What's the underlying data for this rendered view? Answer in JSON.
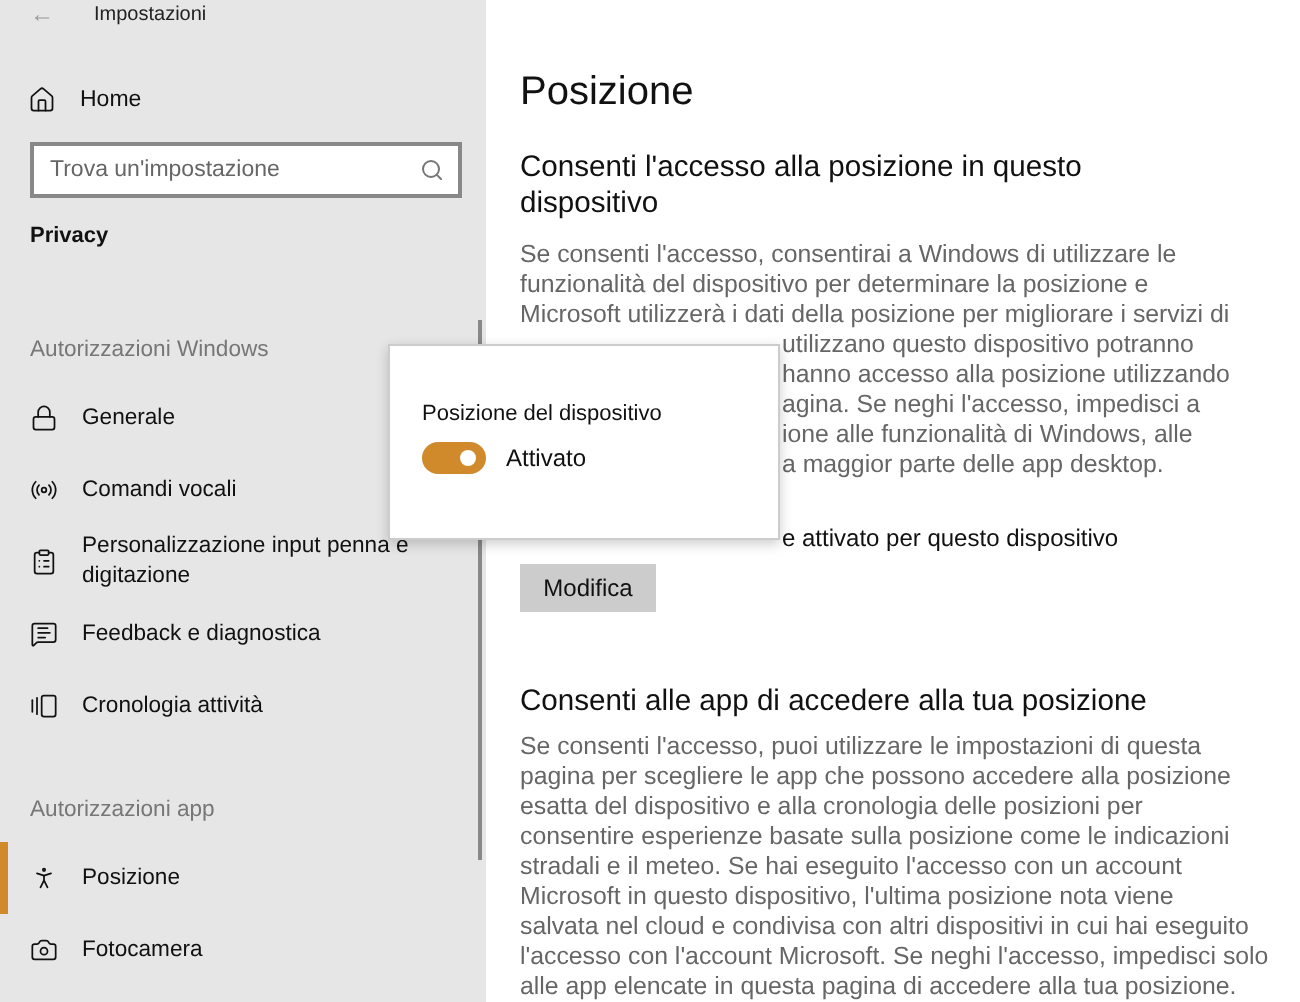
{
  "window": {
    "title": "Impostazioni",
    "back": "←"
  },
  "sidebar": {
    "home": "Home",
    "search": {
      "placeholder": "Trova un'impostazione"
    },
    "category": "Privacy",
    "items": [
      {
        "kind": "header",
        "label": "Autorizzazioni Windows"
      },
      {
        "kind": "item",
        "label": "Generale",
        "selected": false
      },
      {
        "kind": "item",
        "label": "Comandi vocali",
        "selected": false
      },
      {
        "kind": "item",
        "label": "Personalizzazione input penna e digitazione",
        "selected": false
      },
      {
        "kind": "item",
        "label": "Feedback e diagnostica",
        "selected": false
      },
      {
        "kind": "item",
        "label": "Cronologia attività",
        "selected": false
      },
      {
        "kind": "header",
        "label": "Autorizzazioni app"
      },
      {
        "kind": "item",
        "label": "Posizione",
        "selected": true
      },
      {
        "kind": "item",
        "label": "Fotocamera",
        "selected": false
      }
    ]
  },
  "main": {
    "title": "Posizione",
    "section1": {
      "heading": "Consenti l'accesso alla posizione in questo dispositivo",
      "lines": [
        "Se consenti l'accesso, consentirai a Windows di utilizzare le",
        "funzionalità del dispositivo per determinare la posizione e",
        "Microsoft utilizzerà i dati della posizione per migliorare i servizi di"
      ],
      "partial_lines": [
        "utilizzano questo dispositivo potranno",
        "hanno accesso alla posizione utilizzando",
        "agina. Se neghi l'accesso, impedisci a",
        "ione alle funzionalità di Windows, alle",
        "a maggior parte delle app desktop."
      ],
      "status": "e attivato per questo dispositivo",
      "button": "Modifica"
    },
    "section2": {
      "heading": "Consenti alle app di accedere alla tua posizione",
      "lines": [
        "Se consenti l'accesso, puoi utilizzare le impostazioni di questa",
        "pagina per scegliere le app che possono accedere alla posizione",
        "esatta del dispositivo e alla cronologia delle posizioni per",
        "consentire esperienze basate sulla posizione come le indicazioni",
        "stradali e il meteo. Se hai eseguito l'accesso con un account",
        "Microsoft in questo dispositivo, l'ultima posizione nota viene",
        "salvata nel cloud e condivisa con altri dispositivi in cui hai eseguito",
        "l'accesso con l'account Microsoft. Se neghi l'accesso, impedisci solo",
        "alle app elencate in questa pagina di accedere alla tua posizione."
      ]
    }
  },
  "popup": {
    "title": "Posizione del dispositivo",
    "toggle": {
      "on": true,
      "label": "Attivato"
    }
  }
}
